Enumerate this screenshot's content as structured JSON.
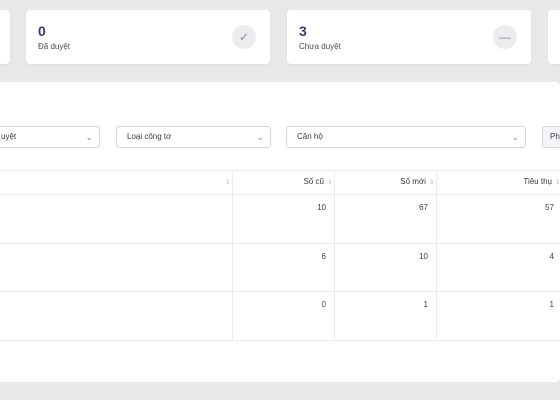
{
  "cards": [
    {
      "value": "0",
      "label": "Đã duyệt",
      "icon": "✓"
    },
    {
      "value": "3",
      "label": "Chưa duyệt",
      "icon": "—"
    }
  ],
  "filters": {
    "status_label": "uyệt",
    "meter_type_placeholder": "Loại công tơ",
    "apartment_placeholder": "Căn hộ",
    "action_button_label": "Ph"
  },
  "table": {
    "headers": {
      "old_reading": "Số cũ",
      "new_reading": "Số mới",
      "consumption": "Tiêu thụ"
    },
    "rows": [
      {
        "old": "10",
        "new": "67",
        "consumption": "57"
      },
      {
        "old": "6",
        "new": "10",
        "consumption": "4"
      },
      {
        "old": "0",
        "new": "1",
        "consumption": "1"
      }
    ]
  }
}
